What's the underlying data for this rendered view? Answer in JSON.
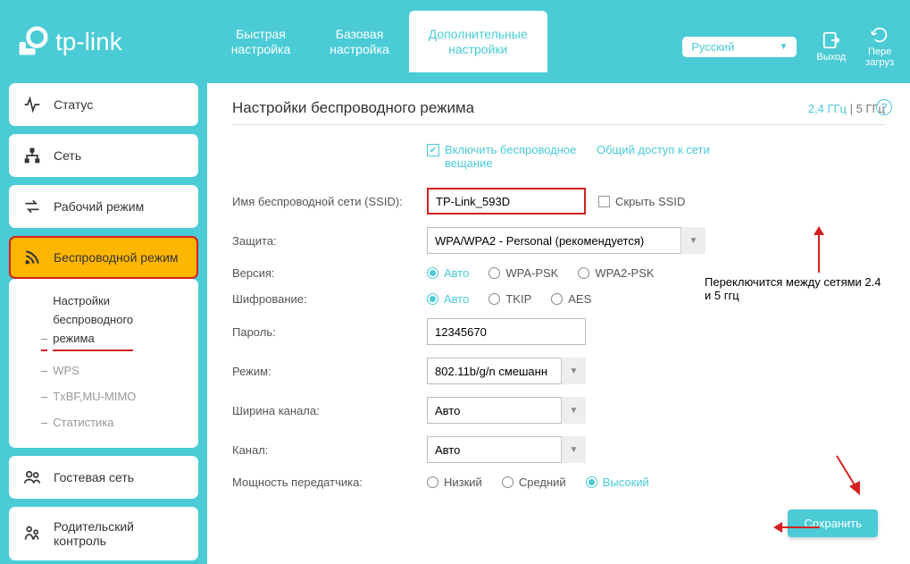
{
  "brand": "tp-link",
  "tabs": {
    "quick": "Быстрая\nнастройка",
    "basic": "Базовая\nнастройка",
    "advanced": "Дополнительные\nнастройки"
  },
  "header": {
    "language": "Русский",
    "logout": "Выход",
    "reload": "Пере\nзагруз"
  },
  "sidebar": {
    "status": "Статус",
    "network": "Сеть",
    "operation": "Рабочий режим",
    "wireless": "Беспроводной режим",
    "guest": "Гостевая сеть",
    "parental": "Родительский контроль",
    "sub_wireless_settings": "Настройки\nбеспроводного\nрежима",
    "sub_wps": "WPS",
    "sub_txbf": "TxBF,MU-MIMO",
    "sub_stats": "Статистика"
  },
  "page": {
    "title": "Настройки беспроводного режима",
    "band_24": "2,4 ГГц",
    "band_5": "5 ГГц",
    "enable_label": "Включить беспроводное вещание",
    "share_label": "Общий доступ к сети",
    "hide_ssid": "Скрыть SSID",
    "save": "Сохранить"
  },
  "labels": {
    "ssid": "Имя беспроводной сети (SSID):",
    "security": "Защита:",
    "version": "Версия:",
    "encryption": "Шифрование:",
    "password": "Пароль:",
    "mode": "Режим:",
    "channel_width": "Ширина канала:",
    "channel": "Канал:",
    "tx_power": "Мощность передатчика:"
  },
  "values": {
    "ssid": "TP-Link_593D",
    "security": "WPA/WPA2 - Personal (рекомендуется)",
    "version_opts": [
      "Авто",
      "WPA-PSK",
      "WPA2-PSK"
    ],
    "encryption_opts": [
      "Авто",
      "TKIP",
      "AES"
    ],
    "password": "12345670",
    "mode": "802.11b/g/n смешанн",
    "channel_width": "Авто",
    "channel": "Авто",
    "tx_power_opts": [
      "Низкий",
      "Средний",
      "Высокий"
    ]
  },
  "annotations": {
    "switch_note": "Переключится между сетями 2.4 и 5 ггц"
  }
}
